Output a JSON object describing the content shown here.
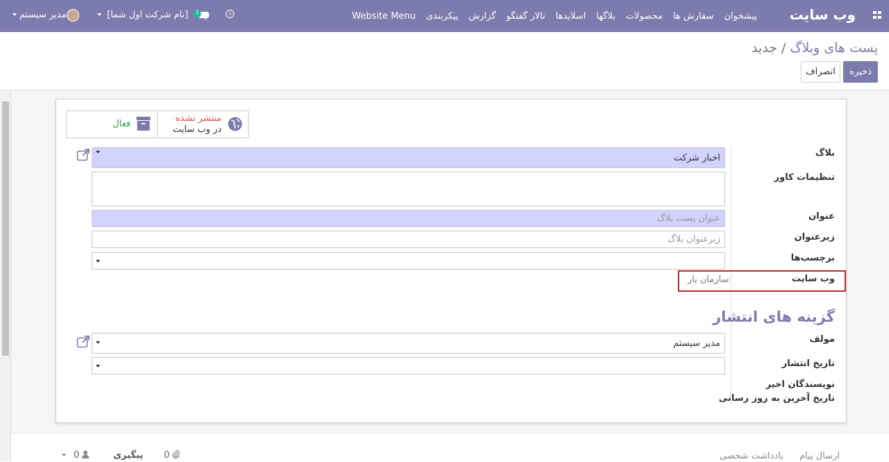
{
  "nav": {
    "brand": "وب سایت",
    "menu": [
      "پیشخوان",
      "سفارش ها",
      "محصولات",
      "بلاگها",
      "اسلایدها",
      "تالار گفتگو",
      "گزارش",
      "پیکربندی",
      "Website Menu"
    ],
    "user": "مدیر سیستم",
    "company": "[نام شرکت اول شما]",
    "messages_count": "1"
  },
  "breadcrumb": {
    "parent": "پست های وبلاگ",
    "separator": " / ",
    "current": "جدید"
  },
  "actions": {
    "save": "ذخیره",
    "discard": "انصراف"
  },
  "status": {
    "published_state": "منتشر نشده",
    "published_sub": "در وب سایت",
    "active": "فعال"
  },
  "labels": {
    "blog": "بلاگ",
    "cover": "تنظیمات کاور",
    "title": "عنوان",
    "subtitle": "زیرعنوان",
    "tags": "برچسب‌ها",
    "website": "وب سایت",
    "publishing_section": "گزینه های انتشار",
    "author": "مولف",
    "publish_date": "تاریخ انتشار",
    "last_contributor": "نویسندگان اخیر",
    "last_updated": "تاریخ آخرین به روز رسانی"
  },
  "values": {
    "blog": "اخبار شرکت",
    "title_placeholder": "عنوان پست بلاگ",
    "subtitle_placeholder": "زیرعنوان بلاگ",
    "website": "سازمان یار",
    "author": "مدیر سیستم"
  },
  "chatter": {
    "send_message": "ارسال پیام",
    "log_note": "یادداشت شخصی",
    "follow": "پیگیری",
    "followers": "0",
    "attachments": "0"
  },
  "colors": {
    "brand": "#7c7bad",
    "required": "#d2d2ff",
    "highlight": "#c0282d",
    "unpublished": "#d9534f",
    "active": "#28a745"
  }
}
